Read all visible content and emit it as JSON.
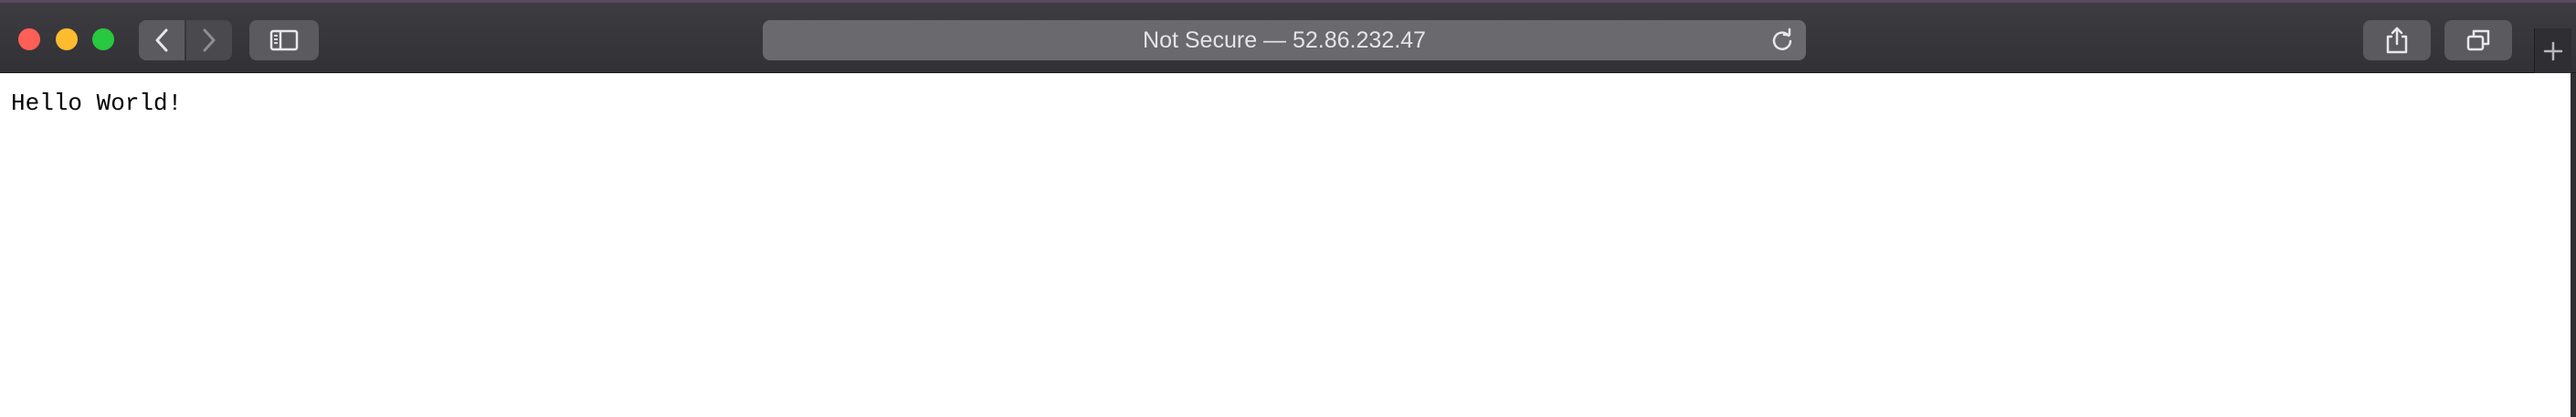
{
  "browser": {
    "address_bar": {
      "text": "Not Secure — 52.86.232.47"
    },
    "icons": {
      "back": "chevron-left-icon",
      "forward": "chevron-right-icon",
      "sidebar": "sidebar-icon",
      "reload": "reload-icon",
      "share": "share-icon",
      "tabs": "tab-overview-icon",
      "new_tab": "plus-icon"
    }
  },
  "page": {
    "body_text": "Hello World!"
  }
}
